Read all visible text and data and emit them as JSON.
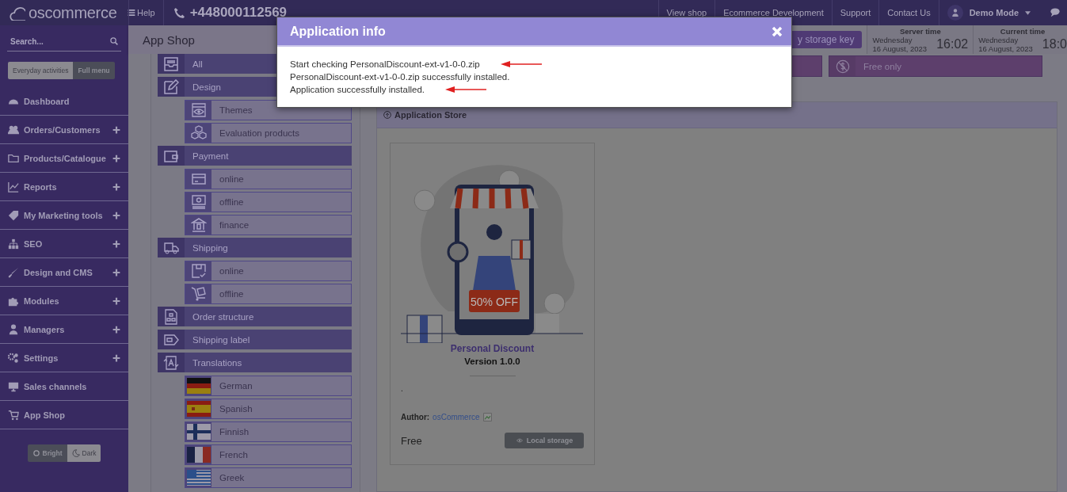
{
  "top_bar": {
    "logo": "oscommerce",
    "help": "Help",
    "phone": "+448000112569",
    "links": [
      "View shop",
      "Ecommerce Development",
      "Support",
      "Contact Us"
    ],
    "user": "Demo Mode"
  },
  "sidebar": {
    "search": {
      "placeholder": "Search..."
    },
    "menu_modes": [
      {
        "label": "Everyday activities",
        "selected": false
      },
      {
        "label": "Full menu",
        "selected": true
      }
    ],
    "items": [
      {
        "label": "Dashboard",
        "kind": "gauge",
        "expandable": false
      },
      {
        "label": "Orders/Customers",
        "kind": "users",
        "expandable": true
      },
      {
        "label": "Products/Catalogue",
        "kind": "folder",
        "expandable": true
      },
      {
        "label": "Reports",
        "kind": "chart",
        "expandable": true
      },
      {
        "label": "My Marketing tools",
        "kind": "tag",
        "expandable": true
      },
      {
        "label": "SEO",
        "kind": "sitemap",
        "expandable": true
      },
      {
        "label": "Design and CMS",
        "kind": "brush",
        "expandable": true
      },
      {
        "label": "Modules",
        "kind": "puzzle",
        "expandable": true
      },
      {
        "label": "Managers",
        "kind": "user",
        "expandable": true
      },
      {
        "label": "Settings",
        "kind": "gears",
        "expandable": true
      },
      {
        "label": "Sales channels",
        "kind": "monitor",
        "expandable": false
      },
      {
        "label": "App Shop",
        "kind": "cart",
        "expandable": false
      }
    ],
    "themes": [
      {
        "label": "Bright",
        "kind": "sun",
        "selected": true
      },
      {
        "label": "Dark",
        "kind": "moon",
        "selected": false
      }
    ]
  },
  "page_header": {
    "title": "App Shop",
    "storage_button": "y storage key",
    "clocks": [
      {
        "label": "Server time",
        "day": "Wednesday",
        "date": "16 August, 2023",
        "time": "16:02"
      },
      {
        "label": "Current time",
        "day": "Wednesday",
        "date": "16 August, 2023",
        "time": "18:0"
      }
    ]
  },
  "filters": [
    {
      "label": "Free only",
      "kind": "dollar"
    }
  ],
  "categories": [
    {
      "label": "All",
      "kind": "inbox"
    },
    {
      "label": "Design",
      "kind": "pencil",
      "children": [
        {
          "label": "Themes",
          "kind": "eye"
        },
        {
          "label": "Evaluation products",
          "kind": "cubes"
        }
      ]
    },
    {
      "label": "Payment",
      "kind": "wallet",
      "children": [
        {
          "label": "online",
          "kind": "card"
        },
        {
          "label": "offline",
          "kind": "banknote"
        },
        {
          "label": "finance",
          "kind": "bank"
        }
      ]
    },
    {
      "label": "Shipping",
      "kind": "truck",
      "children": [
        {
          "label": "online",
          "kind": "box"
        },
        {
          "label": "offline",
          "kind": "trolley"
        }
      ]
    },
    {
      "label": "Order structure",
      "kind": "document"
    },
    {
      "label": "Shipping label",
      "kind": "label"
    },
    {
      "label": "Translations",
      "kind": "translate",
      "children": [
        {
          "label": "German",
          "kind": "flag-de"
        },
        {
          "label": "Spanish",
          "kind": "flag-es"
        },
        {
          "label": "Finnish",
          "kind": "flag-fi"
        },
        {
          "label": "French",
          "kind": "flag-fr"
        },
        {
          "label": "Greek",
          "kind": "flag-gr"
        }
      ]
    }
  ],
  "store": {
    "title": "Application Store",
    "apps": [
      {
        "name": "Personal Discount",
        "version": "Version 1.0.0",
        "picture_text": "50% OFF",
        "description": ".",
        "author_label": "Author:",
        "author": "osCommerce",
        "price": "Free",
        "button": "Local storage"
      }
    ]
  },
  "dialog": {
    "title": "Application info",
    "lines": [
      {
        "text": "Start checking PersonalDiscount-ext-v1-0-0.zip",
        "marked": true
      },
      {
        "text": "PersonalDiscount-ext-v1-0-0.zip successfully installed.",
        "marked": false
      },
      {
        "text": "Application successfully installed.",
        "marked": true
      }
    ]
  }
}
